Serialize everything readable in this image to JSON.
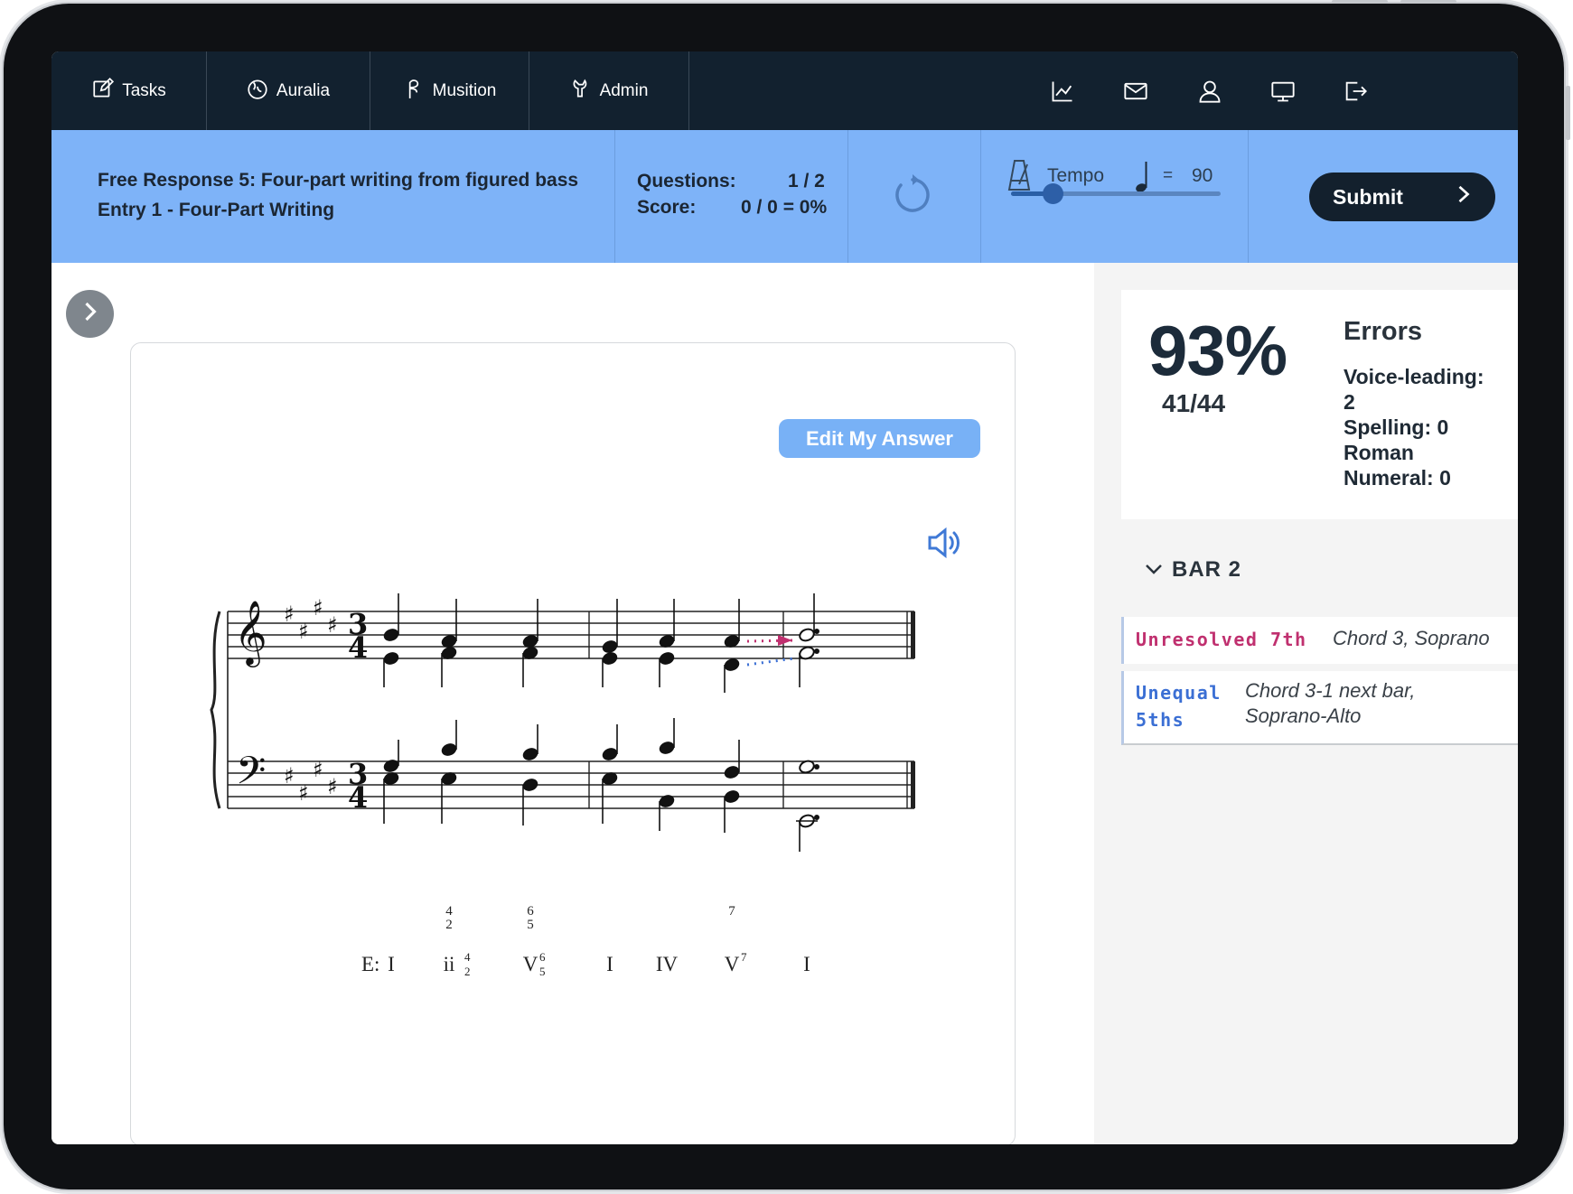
{
  "nav": {
    "items": [
      {
        "label": "Tasks",
        "icon": "edit-icon"
      },
      {
        "label": "Auralia",
        "icon": "auralia-icon"
      },
      {
        "label": "Musition",
        "icon": "musition-icon"
      },
      {
        "label": "Admin",
        "icon": "admin-icon"
      }
    ],
    "right_icons": [
      "chart-icon",
      "mail-icon",
      "user-icon",
      "monitor-icon",
      "logout-icon"
    ]
  },
  "header": {
    "title_line1": "Free Response 5: Four-part writing from figured bass",
    "title_line2": "Entry 1 - Four-Part Writing",
    "questions_label": "Questions:",
    "questions_value": "1 / 2",
    "score_label": "Score:",
    "score_value": "0 / 0 = 0%",
    "tempo_label": "Tempo",
    "tempo_equals": "=",
    "tempo_value": "90",
    "tempo_slider_fraction": 0.2,
    "submit_label": "Submit"
  },
  "main": {
    "edit_button_label": "Edit My Answer",
    "figured_bass": [
      {
        "top": "4",
        "bottom": "2"
      },
      {
        "top": "6",
        "bottom": "5"
      },
      {
        "top": "7",
        "bottom": ""
      }
    ],
    "key_label": "E:",
    "roman_numerals": [
      {
        "base": "I",
        "sup": "",
        "sub": ""
      },
      {
        "base": "ii",
        "sup": "4",
        "sub": "2"
      },
      {
        "base": "V",
        "sup": "6",
        "sub": "5"
      },
      {
        "base": "I",
        "sup": "",
        "sub": ""
      },
      {
        "base": "IV",
        "sup": "",
        "sub": ""
      },
      {
        "base": "V",
        "sup": "7",
        "sub": ""
      },
      {
        "base": "I",
        "sup": "",
        "sub": ""
      }
    ],
    "time_signature": {
      "top": "3",
      "bottom": "4"
    }
  },
  "results": {
    "percent": "93%",
    "fraction": "41/44",
    "errors_heading": "Errors",
    "errors_lines": [
      "Voice-leading:",
      "2",
      "Spelling: 0",
      "Roman",
      "Numeral: 0"
    ],
    "bar_heading": "BAR 2",
    "error_items": [
      {
        "type_lines": [
          "Unresolved 7th"
        ],
        "location_lines": [
          "Chord 3, Soprano"
        ],
        "color": "#c0306f"
      },
      {
        "type_lines": [
          "Unequal",
          "5ths"
        ],
        "location_lines": [
          "Chord 3-1 next bar,",
          "Soprano-Alto"
        ],
        "color": "#3b6fd4"
      }
    ]
  },
  "colors": {
    "nav_bg": "#12212f",
    "band_bg": "#7eb3f8",
    "submit_bg": "#13202d",
    "edit_button_bg": "#78b1f6",
    "unresolved_color": "#c0306f",
    "unequal_color": "#3b6fd4"
  }
}
